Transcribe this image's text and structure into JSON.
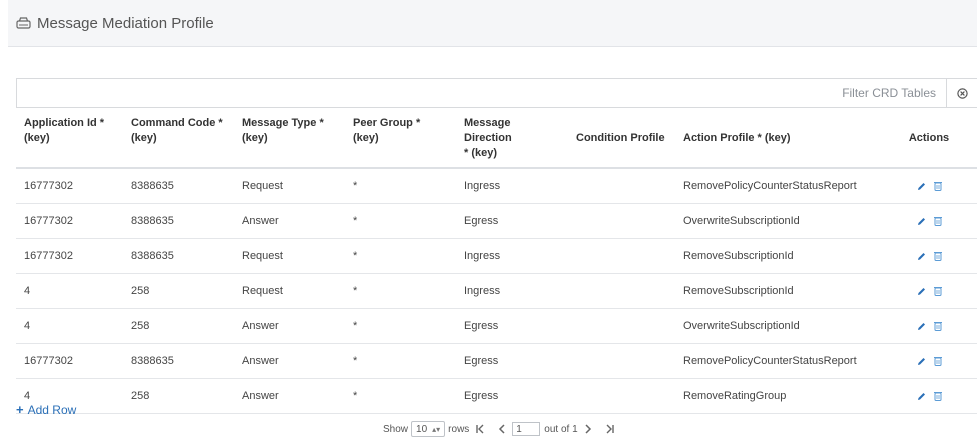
{
  "page": {
    "title": "Message Mediation Profile"
  },
  "filter": {
    "label": "Filter CRD Tables"
  },
  "table": {
    "headers": {
      "app_id": [
        "Application Id *",
        "(key)"
      ],
      "command_code": [
        "Command Code *",
        "(key)"
      ],
      "message_type": [
        "Message Type *",
        "(key)"
      ],
      "peer_group": [
        "Peer Group *",
        "(key)"
      ],
      "message_direction": [
        "Message Direction",
        "* (key)"
      ],
      "condition_profile": "Condition Profile",
      "action_profile": "Action Profile * (key)",
      "actions": "Actions"
    },
    "rows": [
      [
        "16777302",
        "8388635",
        "Request",
        "*",
        "Ingress",
        "",
        "RemovePolicyCounterStatusReport"
      ],
      [
        "16777302",
        "8388635",
        "Answer",
        "*",
        "Egress",
        "",
        "OverwriteSubscriptionId"
      ],
      [
        "16777302",
        "8388635",
        "Request",
        "*",
        "Ingress",
        "",
        "RemoveSubscriptionId"
      ],
      [
        "4",
        "258",
        "Request",
        "*",
        "Ingress",
        "",
        "RemoveSubscriptionId"
      ],
      [
        "4",
        "258",
        "Answer",
        "*",
        "Egress",
        "",
        "OverwriteSubscriptionId"
      ],
      [
        "16777302",
        "8388635",
        "Answer",
        "*",
        "Egress",
        "",
        "RemovePolicyCounterStatusReport"
      ],
      [
        "4",
        "258",
        "Answer",
        "*",
        "Egress",
        "",
        "RemoveRatingGroup"
      ]
    ]
  },
  "add_row": {
    "label": "Add Row"
  },
  "pagination": {
    "show_label": "Show",
    "rows_per_page": "10",
    "rows_label": "rows",
    "current_page": "1",
    "out_of_label": "out of 1"
  },
  "colors": {
    "link": "#2a6fb7",
    "icon": "#2a6fb7"
  }
}
